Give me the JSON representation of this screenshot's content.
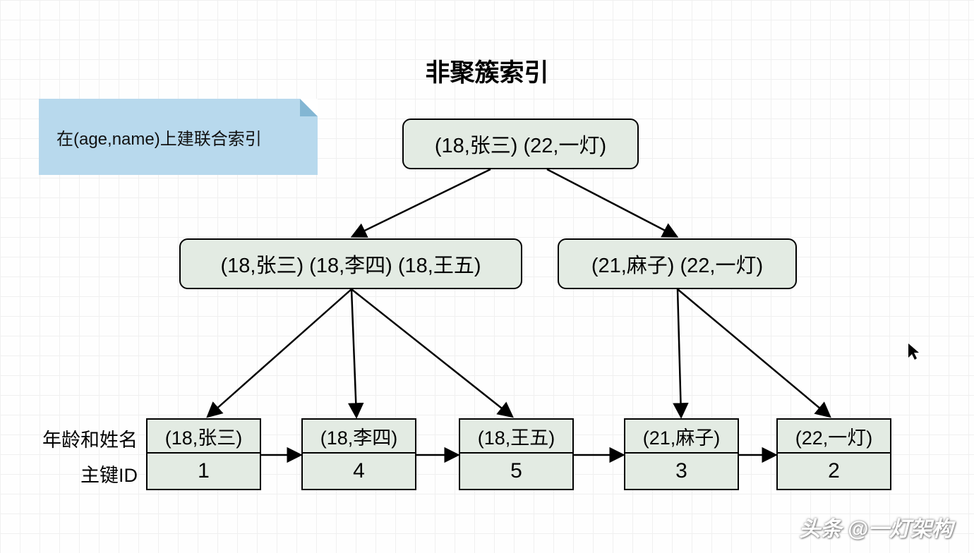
{
  "title": "非聚簇索引",
  "note": "在(age,name)上建联合索引",
  "root": "(18,张三) (22,一灯)",
  "mid_left": "(18,张三) (18,李四) (18,王五)",
  "mid_right": "(21,麻子) (22,一灯)",
  "label_top": "年龄和姓名",
  "label_bot": "主键ID",
  "leaves": [
    {
      "top": "(18,张三)",
      "bot": "1"
    },
    {
      "top": "(18,李四)",
      "bot": "4"
    },
    {
      "top": "(18,王五)",
      "bot": "5"
    },
    {
      "top": "(21,麻子)",
      "bot": "3"
    },
    {
      "top": "(22,一灯)",
      "bot": "2"
    }
  ],
  "watermark": "头条 @一灯架构"
}
